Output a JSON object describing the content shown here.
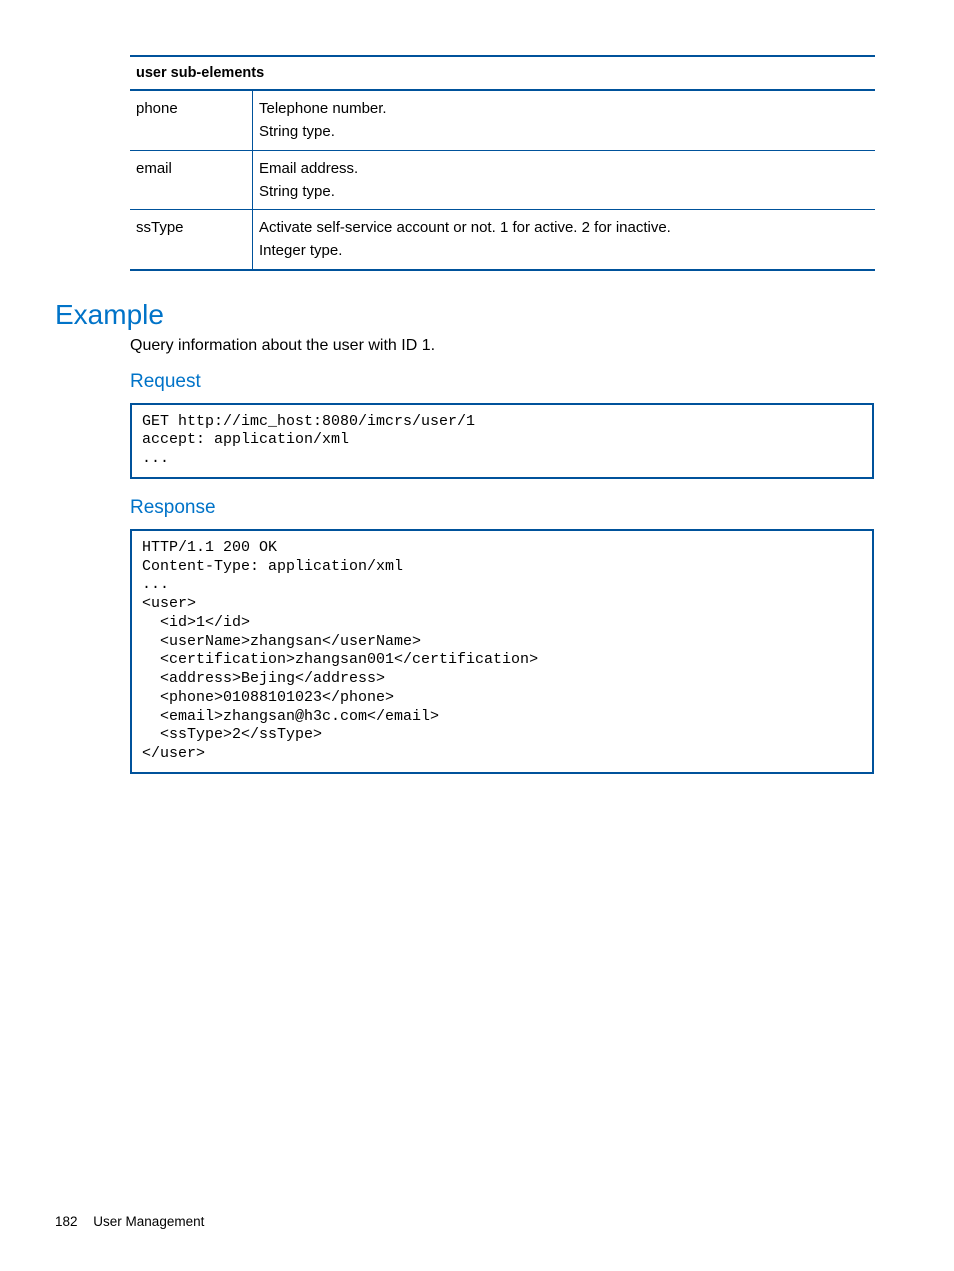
{
  "table": {
    "header": "user sub-elements",
    "rows": [
      {
        "name": "phone",
        "desc_l1": "Telephone number.",
        "desc_l2": "String type."
      },
      {
        "name": "email",
        "desc_l1": "Email address.",
        "desc_l2": "String type."
      },
      {
        "name": "ssType",
        "desc_l1": "Activate self-service account or not. 1 for active. 2 for inactive.",
        "desc_l2": "Integer type."
      }
    ]
  },
  "section": {
    "heading": "Example",
    "intro": "Query information about the user with ID 1.",
    "request_heading": "Request",
    "request_code": "GET http://imc_host:8080/imcrs/user/1\naccept: application/xml\n...",
    "response_heading": "Response",
    "response_code": "HTTP/1.1 200 OK\nContent-Type: application/xml\n...\n<user>\n  <id>1</id>\n  <userName>zhangsan</userName>\n  <certification>zhangsan001</certification>\n  <address>Bejing</address>\n  <phone>01088101023</phone>\n  <email>zhangsan@h3c.com</email>\n  <ssType>2</ssType>\n</user>"
  },
  "footer": {
    "page_number": "182",
    "chapter": "User Management"
  }
}
